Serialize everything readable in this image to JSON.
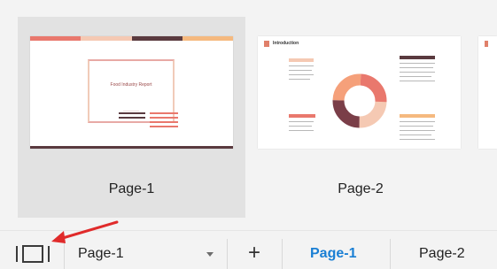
{
  "thumbnails": [
    {
      "label": "Page-1",
      "selected": true,
      "slide_title": "Food Industry Report"
    },
    {
      "label": "Page-2",
      "selected": false,
      "slide_title": "Introduction"
    }
  ],
  "bottom_bar": {
    "panel_icon": "page-panel-icon",
    "page_select_value": "Page-1",
    "add_label": "+",
    "tabs": [
      {
        "label": "Page-1",
        "active": true
      },
      {
        "label": "Page-2",
        "active": false
      }
    ]
  },
  "annotation": {
    "arrow_color": "#e02b2b"
  },
  "colors": {
    "accent": "#1a7fd4",
    "selected_bg": "#e2e2e2",
    "salmon": "#e9786d",
    "peach": "#f5b97f",
    "maroon": "#5a3a3f"
  }
}
